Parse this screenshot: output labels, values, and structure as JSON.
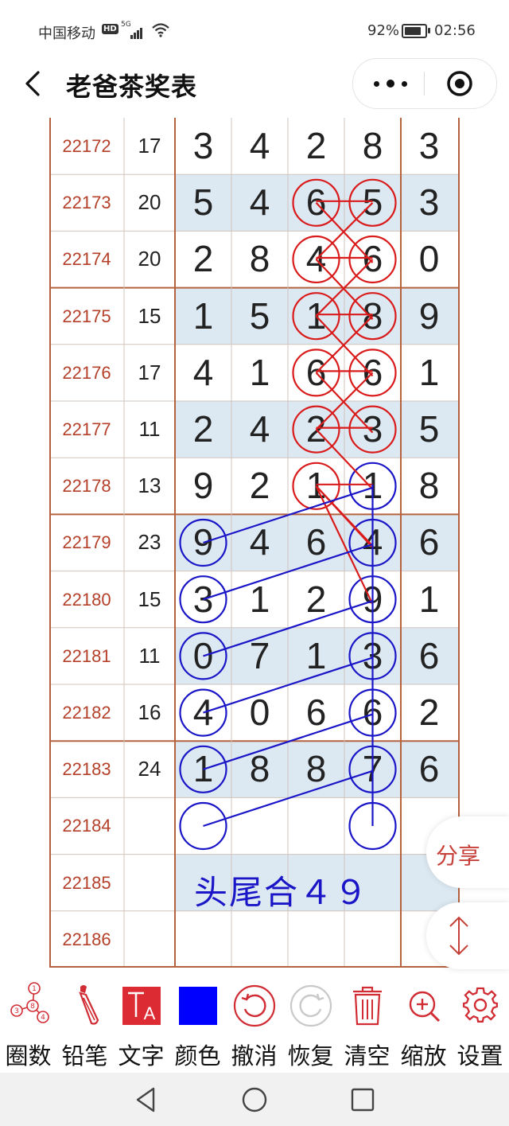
{
  "status_bar": {
    "carrier": "中国移动",
    "hd": "HD",
    "network": "5G",
    "battery_percent": "92%",
    "battery_level": 0.92,
    "time": "02:56"
  },
  "header": {
    "title": "老爸茶奖表",
    "back_icon": "chevron-left-icon",
    "more_icon": "more-dots-icon",
    "close_icon": "target-icon"
  },
  "table": {
    "rows": [
      {
        "issue": "22172",
        "sum": "17",
        "digits": [
          "3",
          "4",
          "2",
          "8",
          "3"
        ],
        "shaded": false
      },
      {
        "issue": "22173",
        "sum": "20",
        "digits": [
          "5",
          "4",
          "6",
          "5",
          "3"
        ],
        "shaded": true
      },
      {
        "issue": "22174",
        "sum": "20",
        "digits": [
          "2",
          "8",
          "4",
          "6",
          "0"
        ],
        "shaded": false
      },
      {
        "issue": "22175",
        "sum": "15",
        "digits": [
          "1",
          "5",
          "1",
          "8",
          "9"
        ],
        "shaded": true
      },
      {
        "issue": "22176",
        "sum": "17",
        "digits": [
          "4",
          "1",
          "6",
          "6",
          "1"
        ],
        "shaded": false
      },
      {
        "issue": "22177",
        "sum": "11",
        "digits": [
          "2",
          "4",
          "2",
          "3",
          "5"
        ],
        "shaded": true
      },
      {
        "issue": "22178",
        "sum": "13",
        "digits": [
          "9",
          "2",
          "1",
          "1",
          "8"
        ],
        "shaded": false
      },
      {
        "issue": "22179",
        "sum": "23",
        "digits": [
          "9",
          "4",
          "6",
          "4",
          "6"
        ],
        "shaded": true
      },
      {
        "issue": "22180",
        "sum": "15",
        "digits": [
          "3",
          "1",
          "2",
          "9",
          "1"
        ],
        "shaded": false
      },
      {
        "issue": "22181",
        "sum": "11",
        "digits": [
          "0",
          "7",
          "1",
          "3",
          "6"
        ],
        "shaded": true
      },
      {
        "issue": "22182",
        "sum": "16",
        "digits": [
          "4",
          "0",
          "6",
          "6",
          "2"
        ],
        "shaded": false
      },
      {
        "issue": "22183",
        "sum": "24",
        "digits": [
          "1",
          "8",
          "8",
          "7",
          "6"
        ],
        "shaded": true
      },
      {
        "issue": "22184",
        "sum": "",
        "digits": [
          "",
          "",
          "",
          "",
          ""
        ],
        "shaded": false
      },
      {
        "issue": "22185",
        "sum": "",
        "digits": [
          "",
          "",
          "",
          "",
          ""
        ],
        "shaded": true
      },
      {
        "issue": "22186",
        "sum": "",
        "digits": [
          "",
          "",
          "",
          "",
          ""
        ],
        "shaded": false
      }
    ],
    "note": "头尾合４９",
    "colors": {
      "issue_text": "#b5402a",
      "shaded_row": "#dde9f2",
      "grid_line": "#b5623e",
      "red_mark": "#d91b1b",
      "blue_mark": "#1a16c8"
    }
  },
  "annotations": {
    "red_circles": [
      [
        1,
        2
      ],
      [
        1,
        3
      ],
      [
        2,
        2
      ],
      [
        2,
        3
      ],
      [
        3,
        2
      ],
      [
        3,
        3
      ],
      [
        4,
        2
      ],
      [
        4,
        3
      ],
      [
        5,
        2
      ],
      [
        5,
        3
      ],
      [
        6,
        2
      ]
    ],
    "blue_circles": [
      [
        6,
        3
      ],
      [
        7,
        0
      ],
      [
        7,
        3
      ],
      [
        8,
        0
      ],
      [
        8,
        3
      ],
      [
        9,
        0
      ],
      [
        9,
        3
      ],
      [
        10,
        0
      ],
      [
        10,
        3
      ],
      [
        11,
        0
      ],
      [
        11,
        3
      ],
      [
        12,
        0
      ],
      [
        12,
        3
      ]
    ]
  },
  "floating": {
    "share_label": "分享",
    "scroll_icon": "up-down-arrows-icon"
  },
  "toolbar": {
    "items": [
      {
        "id": "circle",
        "label": "圈数",
        "icon": "circle-numbers-icon"
      },
      {
        "id": "pencil",
        "label": "铅笔",
        "icon": "pencil-icon"
      },
      {
        "id": "text",
        "label": "文字",
        "icon": "text-icon"
      },
      {
        "id": "color",
        "label": "颜色",
        "icon": "color-swatch-icon",
        "value": "#0000ff"
      },
      {
        "id": "undo",
        "label": "撤消",
        "icon": "undo-icon"
      },
      {
        "id": "redo",
        "label": "恢复",
        "icon": "redo-icon"
      },
      {
        "id": "clear",
        "label": "清空",
        "icon": "trash-icon"
      },
      {
        "id": "zoom",
        "label": "缩放",
        "icon": "zoom-in-icon"
      },
      {
        "id": "settings",
        "label": "设置",
        "icon": "gear-icon"
      }
    ]
  },
  "nav": {
    "back_icon": "triangle-back-icon",
    "home_icon": "circle-home-icon",
    "recent_icon": "square-recent-icon"
  }
}
